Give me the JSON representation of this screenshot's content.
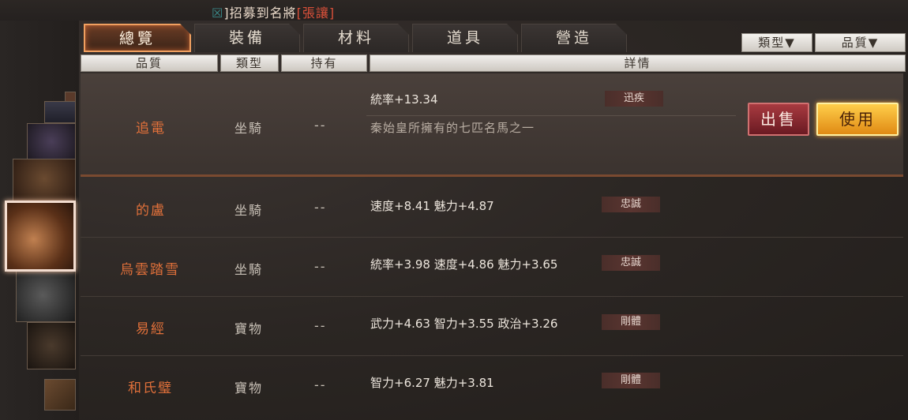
{
  "notice": {
    "prefix": "招募到名將",
    "name": "張讓",
    "lead": "]"
  },
  "tabs": [
    {
      "label": "總覽",
      "active": true
    },
    {
      "label": "裝備",
      "active": false
    },
    {
      "label": "材料",
      "active": false
    },
    {
      "label": "道具",
      "active": false
    },
    {
      "label": "營造",
      "active": false
    }
  ],
  "filters": {
    "type": "類型▼",
    "quality": "品質▼"
  },
  "columns": {
    "quality": "品質",
    "type": "類型",
    "owned": "持有",
    "detail": "詳情"
  },
  "items": [
    {
      "name": "追電",
      "type": "坐騎",
      "owned": "--",
      "stats": "統率+13.34",
      "trait": "迅疾",
      "desc": "秦始皇所擁有的七匹名馬之一",
      "selected": true
    },
    {
      "name": "的盧",
      "type": "坐騎",
      "owned": "--",
      "stats": "速度+8.41  魅力+4.87",
      "trait": "忠誠",
      "selected": false
    },
    {
      "name": "烏雲踏雪",
      "type": "坐騎",
      "owned": "--",
      "stats": "統率+3.98  速度+4.86  魅力+3.65",
      "trait": "忠誠",
      "selected": false
    },
    {
      "name": "易經",
      "type": "寶物",
      "owned": "--",
      "stats": "武力+4.63  智力+3.55  政治+3.26",
      "trait": "剛體",
      "selected": false
    },
    {
      "name": "和氏璧",
      "type": "寶物",
      "owned": "--",
      "stats": "智力+6.27  魅力+3.81",
      "trait": "剛體",
      "selected": false
    }
  ],
  "actions": {
    "sell": "出售",
    "use": "使用"
  },
  "colors": {
    "accent": "#e0703a",
    "tab_active": "#f0a060",
    "use_button": "#f3a92a",
    "sell_button": "#8a2a32"
  }
}
